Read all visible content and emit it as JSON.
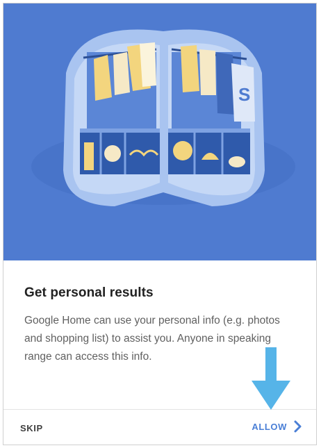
{
  "screen": {
    "title": "Get personal results",
    "description": "Google Home can use your personal info (e.g. photos and shopping list) to assist you. Anyone in speaking range can access this info."
  },
  "actions": {
    "skip_label": "SKIP",
    "allow_label": "ALLOW"
  },
  "colors": {
    "hero_background": "#4f7bd0",
    "accent": "#4a7fd6",
    "callout_arrow": "#56b4e8"
  },
  "icons": {
    "allow": "chevron-right-icon",
    "illustration": "closet-illustration",
    "callout": "down-arrow-icon"
  }
}
